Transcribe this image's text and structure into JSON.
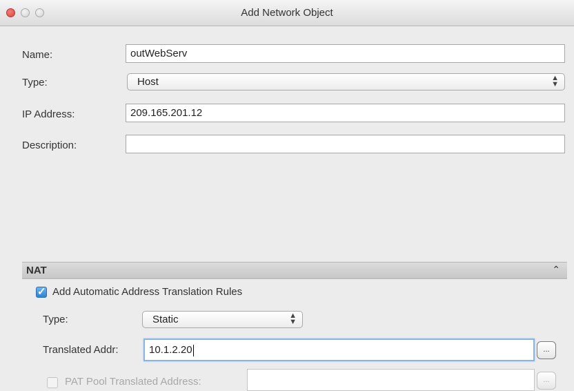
{
  "window": {
    "title": "Add Network Object"
  },
  "form": {
    "name_label": "Name:",
    "name_value": "outWebServ",
    "type_label": "Type:",
    "type_value": "Host",
    "ip_label": "IP Address:",
    "ip_value": "209.165.201.12",
    "description_label": "Description:",
    "description_value": ""
  },
  "nat": {
    "header": "NAT",
    "collapse_icon": "double-chevron-up-icon",
    "auto_rules_label": "Add Automatic Address Translation Rules",
    "auto_rules_checked": true,
    "type_label": "Type:",
    "type_value": "Static",
    "translated_label": "Translated Addr:",
    "translated_value": "10.1.2.20",
    "browse_label": "...",
    "pat_label": "PAT Pool Translated Address:",
    "pat_checked": false,
    "pat_value": ""
  }
}
